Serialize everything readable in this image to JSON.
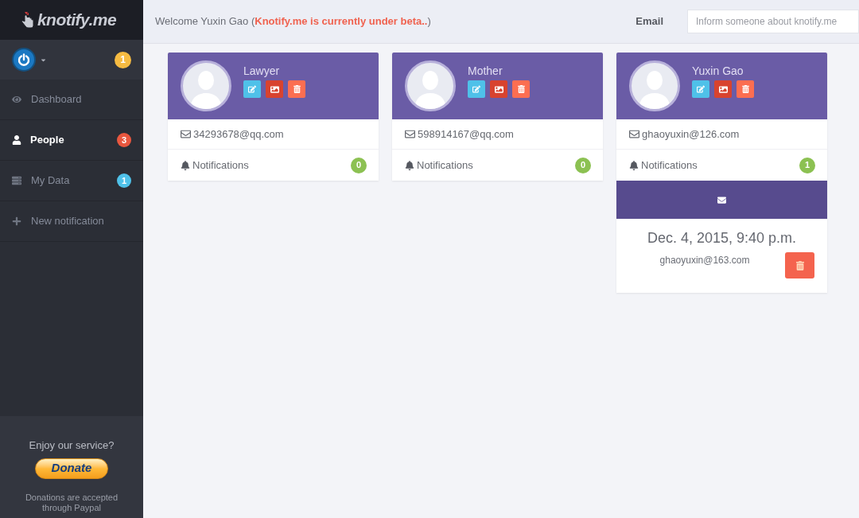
{
  "sidebar": {
    "logo": "knotify.me",
    "user_badge": "1",
    "nav": [
      {
        "label": "Dashboard",
        "selected": false
      },
      {
        "label": "People",
        "selected": true,
        "badge": {
          "text": "3",
          "color": "#e9573f"
        }
      },
      {
        "label": "My Data",
        "selected": false,
        "badge": {
          "text": "1",
          "color": "#4fc1e9"
        }
      },
      {
        "label": "New notification",
        "selected": false
      }
    ],
    "footer": {
      "prompt": "Enjoy our service?",
      "donate_button": "Donate",
      "note": "Donations are accepted through Paypal"
    }
  },
  "header": {
    "welcome": "Welcome Yuxin Gao (**Knotify.me is currently under beta..**)",
    "invite": {
      "label": "Email",
      "placeholder": "Inform someone about knotify.me"
    }
  },
  "people": [
    {
      "name": "Lawyer",
      "email": "34293678@qq.com",
      "notifications_label": "Notifications",
      "notification_count": "0"
    },
    {
      "name": "Mother",
      "email": "598914167@qq.com",
      "notifications_label": "Notifications",
      "notification_count": "0"
    },
    {
      "name": "Yuxin Gao",
      "email": "ghaoyuxin@126.com",
      "notifications_label": "Notifications",
      "notification_count": "1",
      "notifications": [
        {
          "date": "Dec. 4, 2015, 9:40 p.m.",
          "recipient": "ghaoyuxin@163.com"
        }
      ]
    }
  ]
}
